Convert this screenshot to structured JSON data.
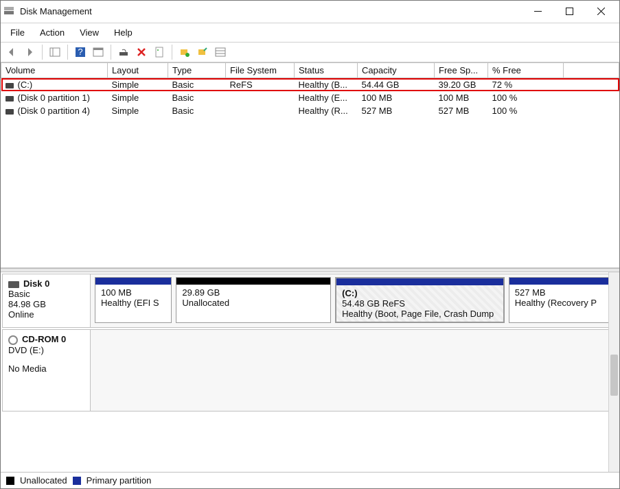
{
  "app": {
    "title": "Disk Management"
  },
  "menu": {
    "file": "File",
    "action": "Action",
    "view": "View",
    "help": "Help"
  },
  "columns": {
    "volume": "Volume",
    "layout": "Layout",
    "type": "Type",
    "fs": "File System",
    "status": "Status",
    "capacity": "Capacity",
    "freesp": "Free Sp...",
    "pctfree": "% Free"
  },
  "volumes": [
    {
      "name": "(C:)",
      "layout": "Simple",
      "type": "Basic",
      "fs": "ReFS",
      "status": "Healthy (B...",
      "capacity": "54.44 GB",
      "free": "39.20 GB",
      "pct": "72 %",
      "highlight": true
    },
    {
      "name": "(Disk 0 partition 1)",
      "layout": "Simple",
      "type": "Basic",
      "fs": "",
      "status": "Healthy (E...",
      "capacity": "100 MB",
      "free": "100 MB",
      "pct": "100 %"
    },
    {
      "name": "(Disk 0 partition 4)",
      "layout": "Simple",
      "type": "Basic",
      "fs": "",
      "status": "Healthy (R...",
      "capacity": "527 MB",
      "free": "527 MB",
      "pct": "100 %"
    }
  ],
  "disk0": {
    "label": "Disk 0",
    "type": "Basic",
    "size": "84.98 GB",
    "state": "Online",
    "parts": [
      {
        "name": "",
        "size": "100 MB",
        "status": "Healthy (EFI S",
        "kind": "primary",
        "grow": 1
      },
      {
        "name": "",
        "size": "29.89 GB",
        "status": "Unallocated",
        "kind": "unalloc",
        "grow": 2.2
      },
      {
        "name": "(C:)",
        "size": "54.48 GB ReFS",
        "status": "Healthy (Boot, Page File, Crash Dump",
        "kind": "primary",
        "grow": 2.4,
        "selected": true
      },
      {
        "name": "",
        "size": "527 MB",
        "status": "Healthy (Recovery P",
        "kind": "primary",
        "grow": 1.4
      }
    ]
  },
  "cdrom": {
    "label": "CD-ROM 0",
    "sub": "DVD (E:)",
    "state": "No Media"
  },
  "legend": {
    "unalloc": "Unallocated",
    "primary": "Primary partition"
  }
}
